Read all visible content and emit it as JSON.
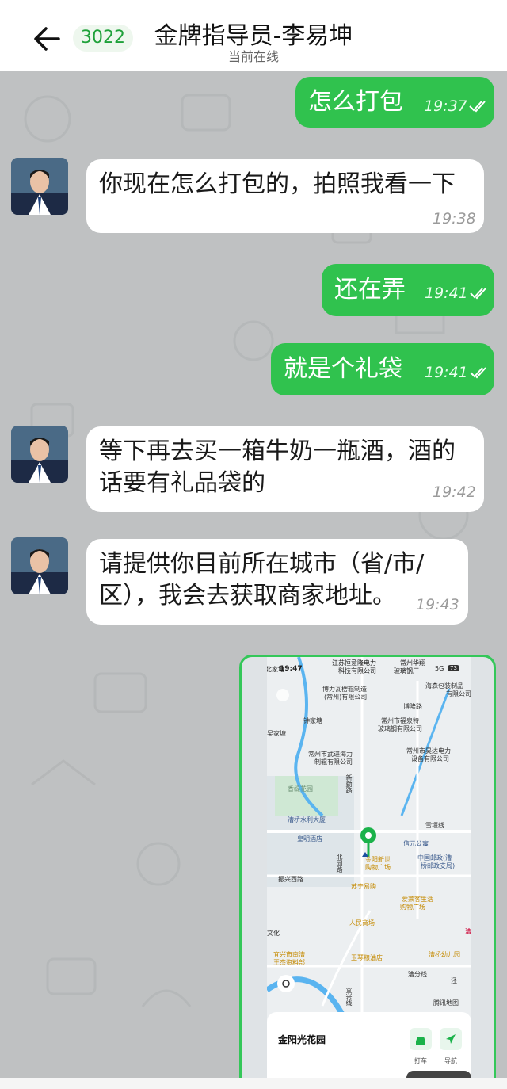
{
  "header": {
    "back_label": "",
    "unread_count": "3022",
    "title": "金牌指导员-李易坤",
    "status": "当前在线"
  },
  "messages": [
    {
      "direction": "out",
      "text": "怎么打包",
      "time": "19:37"
    },
    {
      "direction": "in",
      "text": "你现在怎么打包的，拍照我看一下",
      "time": "19:38"
    },
    {
      "direction": "out",
      "text": "还在弄",
      "time": "19:41"
    },
    {
      "direction": "out",
      "text": "就是个礼袋",
      "time": "19:41"
    },
    {
      "direction": "in",
      "text_line1": "等下再去买一箱牛奶一瓶酒，酒的",
      "text_line2": "话要有礼品袋的",
      "time": "19:42"
    },
    {
      "direction": "in",
      "text_line1": "请提供你目前所在城市（省/市/",
      "text_line2": "区），我会去获取商家地址。",
      "time": "19:43"
    }
  ],
  "screenshot": {
    "status_time": "19:47",
    "status_left": "北家塘",
    "status_net": "5G",
    "status_battery": "73",
    "top_labels": [
      "江苏恒意隆电力",
      "科技有限公司",
      "常州华翔",
      "玻璃钢厂"
    ],
    "map_labels": {
      "l1": "博力瓦楞辊制造",
      "l2": "(常州)有限公司",
      "l3": "海森包装制品",
      "l4": "有限公司",
      "l5": "博隆路",
      "l6": "钟家塘",
      "l7": "常州市福泉特",
      "l8": "玻璃钢有限公司",
      "l9": "吴家塘",
      "l10": "常州市武进海力",
      "l11": "制辊有限公司",
      "l12": "常州市昊达电力",
      "l13": "设备有限公司",
      "l14": "新勤路",
      "l15": "香缇花园",
      "l16": "漕桥水利大厦",
      "l17": "雪堰线",
      "l18": "皇明酒店",
      "l19": "信元公寓",
      "l20": "金阳新世",
      "l21": "购物广场",
      "l22": "中国邮政(漕",
      "l23": "桥邮政支局)",
      "l24": "北园路",
      "l25": "振兴西路",
      "l26": "苏宁易购",
      "l27": "爱莱客生活",
      "l28": "购物广场",
      "l29": "人民商场",
      "l30": "文化",
      "l31": "宜兴市南漕",
      "l32": "王杰资料部",
      "l33": "玉琴粮油店",
      "l34": "漕桥幼儿园",
      "l35": "漕分线",
      "l36": "腾讯地图",
      "l37": "漕",
      "l38": "泾",
      "l39": "宜兴线"
    },
    "sheet_title": "金阳光花园",
    "btn_taxi": "打车",
    "btn_nav": "导航"
  },
  "colors": {
    "out_bubble": "#30c24e",
    "in_bubble": "#ffffff",
    "chat_bg": "#bfc1c2",
    "accent": "#1fa13a"
  },
  "icons": {
    "back": "arrow-left-icon",
    "read": "double-check-icon",
    "avatar": "agent-avatar"
  }
}
